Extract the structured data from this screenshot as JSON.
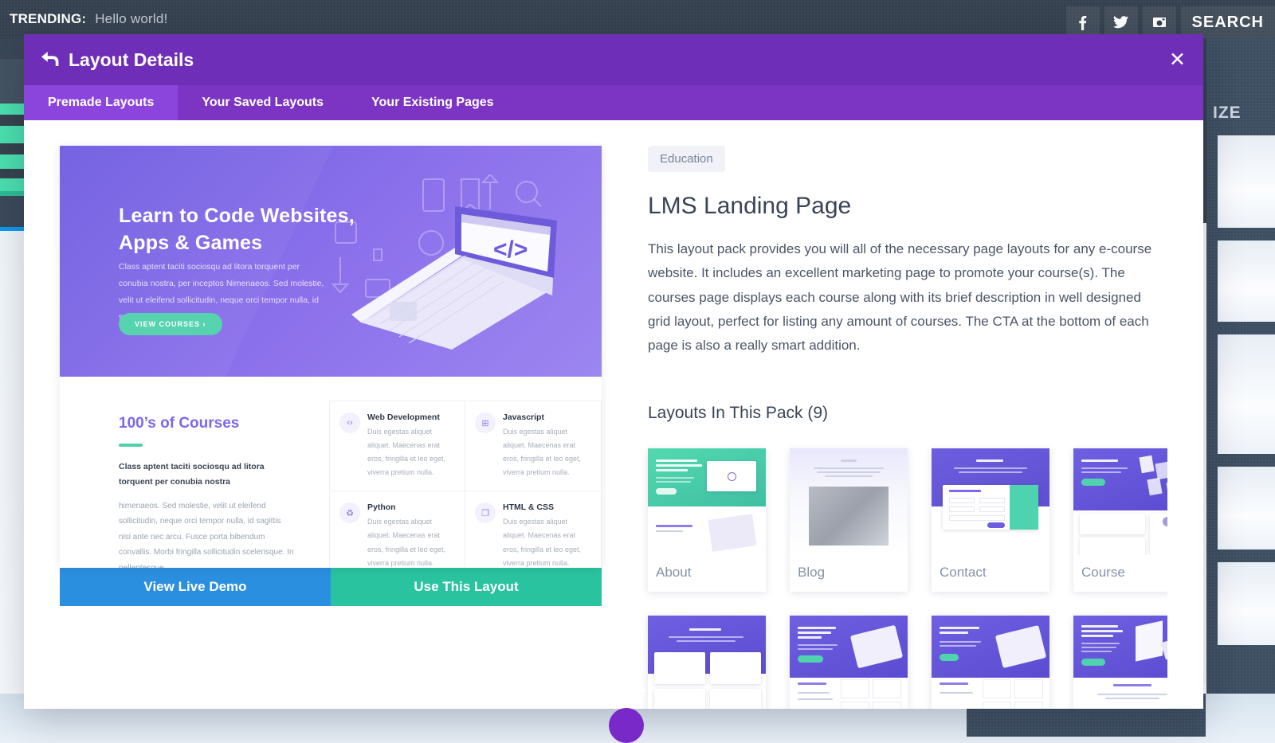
{
  "background": {
    "trending_label": "TRENDING:",
    "trending_post": "Hello world!",
    "social": [
      {
        "name": "facebook-icon",
        "glyph": "f"
      },
      {
        "name": "twitter-icon",
        "glyph": "✉"
      },
      {
        "name": "instagram-icon",
        "glyph": "▣"
      }
    ],
    "search_label": "SEARCH",
    "sidebar_title": "IZE"
  },
  "modal": {
    "title": "Layout Details",
    "back_icon": "↩",
    "close_icon": "✕",
    "tabs": [
      {
        "label": "Premade Layouts",
        "active": true
      },
      {
        "label": "Your Saved Layouts",
        "active": false
      },
      {
        "label": "Your Existing Pages",
        "active": false
      }
    ]
  },
  "preview": {
    "hero_title_line1": "Learn to Code Websites,",
    "hero_title_line2": "Apps & Games",
    "hero_paragraph": "Class aptent taciti sociosqu ad litora torquent per conubia nostra, per inceptos Nimenaeos. Sed molestie, velit ut eleifend sollicitudin, neque orci tempor nulla, id sagittis nisi ante nec arcu.",
    "hero_button": "VIEW COURSES  ›",
    "section_title": "100’s of Courses",
    "section_subtitle": "Class aptent taciti sociosqu ad litora torquent per conubia nostra",
    "section_body": "himenaeos. Sed molestie, velit ut eleifend sollicitudin, neque orci tempor nulla, id sagittis nisi ante nec arcu. Fusce porta bibendum convallis. Morbi fringilla sollicitudin scelerisque. In pellentesque",
    "features": [
      {
        "title": "Web Development",
        "desc": "Duis egestas aliquet aliquet. Maecenas erat eros, fringilla et leo eget, viverra pretium nulla.",
        "icon": "code-file-icon",
        "glyph": "‹›"
      },
      {
        "title": "Javascript",
        "desc": "Duis egestas aliquet aliquet. Maecenas erat eros, fringilla et leo eget, viverra pretium nulla.",
        "icon": "grid-icon",
        "glyph": "⊞"
      },
      {
        "title": "Python",
        "desc": "Duis egestas aliquet aliquet. Maecenas erat eros, fringilla et leo eget, viverra pretium nulla.",
        "icon": "python-icon",
        "glyph": "♻"
      },
      {
        "title": "HTML & CSS",
        "desc": "Duis egestas aliquet aliquet. Maecenas erat eros, fringilla et leo eget, viverra pretium nulla.",
        "icon": "documents-icon",
        "glyph": "❐"
      }
    ],
    "view_demo_label": "View Live Demo",
    "use_layout_label": "Use This Layout"
  },
  "details": {
    "category": "Education",
    "title": "LMS Landing Page",
    "description": "This layout pack provides you will all of the necessary page layouts for any e-course website. It includes an excellent marketing page to promote your course(s). The courses page displays each course along with its brief description in well designed grid layout, perfect for listing any amount of courses. The CTA at the bottom of each page is also a really smart addition.",
    "pack_heading": "Layouts In This Pack (9)",
    "pack_count": 9,
    "layouts": [
      {
        "label": "About",
        "style": "about"
      },
      {
        "label": "Blog",
        "style": "blog"
      },
      {
        "label": "Contact",
        "style": "contact"
      },
      {
        "label": "Course",
        "style": "course"
      },
      {
        "label": "",
        "style": "courses"
      },
      {
        "label": "",
        "style": "landing1"
      },
      {
        "label": "",
        "style": "landing2"
      },
      {
        "label": "",
        "style": "landing3"
      }
    ]
  },
  "colors": {
    "modal_header": "#6f2eb8",
    "tab_bar": "#7b35c2",
    "tab_active": "#8b45dd",
    "demo_button": "#2b8fe0",
    "use_button": "#2ac3a0",
    "accent_green": "#4fd1ab",
    "accent_purple": "#7b68ee",
    "topbar": "#364250",
    "sidebar_dark": "#3d4f61"
  }
}
